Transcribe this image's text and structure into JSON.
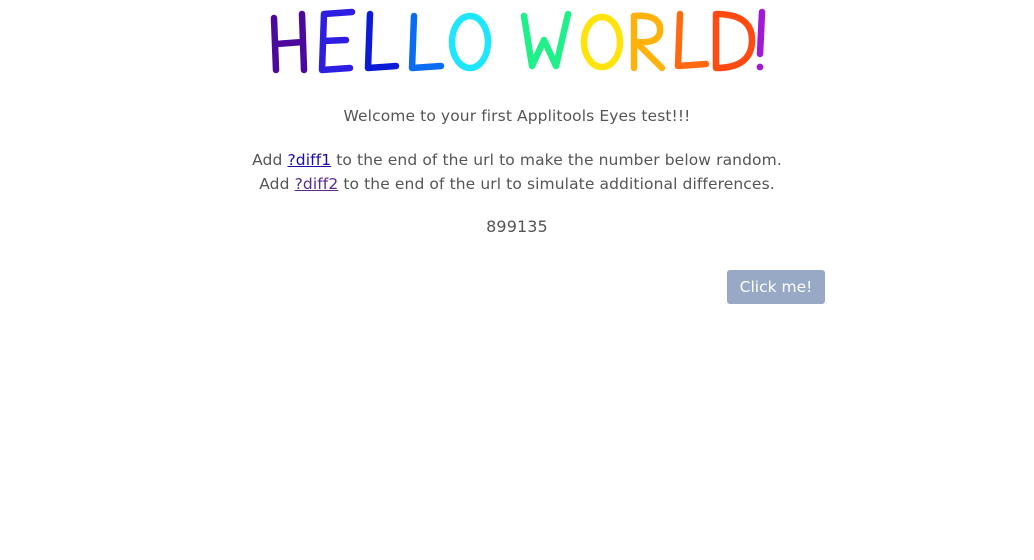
{
  "logo": {
    "text": "HELLO WORLD!",
    "colors": [
      "#4b0a9b",
      "#2e1fe0",
      "#0c1cd6",
      "#0a6cf0",
      "#1ee6ff",
      "#1ff08a",
      "#1de24e",
      "#ffe30a",
      "#ffb30a",
      "#ff6a10",
      "#ff4a12",
      "#a219d8"
    ]
  },
  "content": {
    "welcome": "Welcome to your first Applitools Eyes test!!!",
    "diff1_prefix": "Add ",
    "diff1_link": "?diff1",
    "diff1_suffix": " to the end of the url to make the number below random.",
    "diff2_prefix": "Add ",
    "diff2_link": "?diff2",
    "diff2_suffix": " to the end of the url to simulate additional differences.",
    "number": "899135"
  },
  "button": {
    "label": "Click me!"
  }
}
